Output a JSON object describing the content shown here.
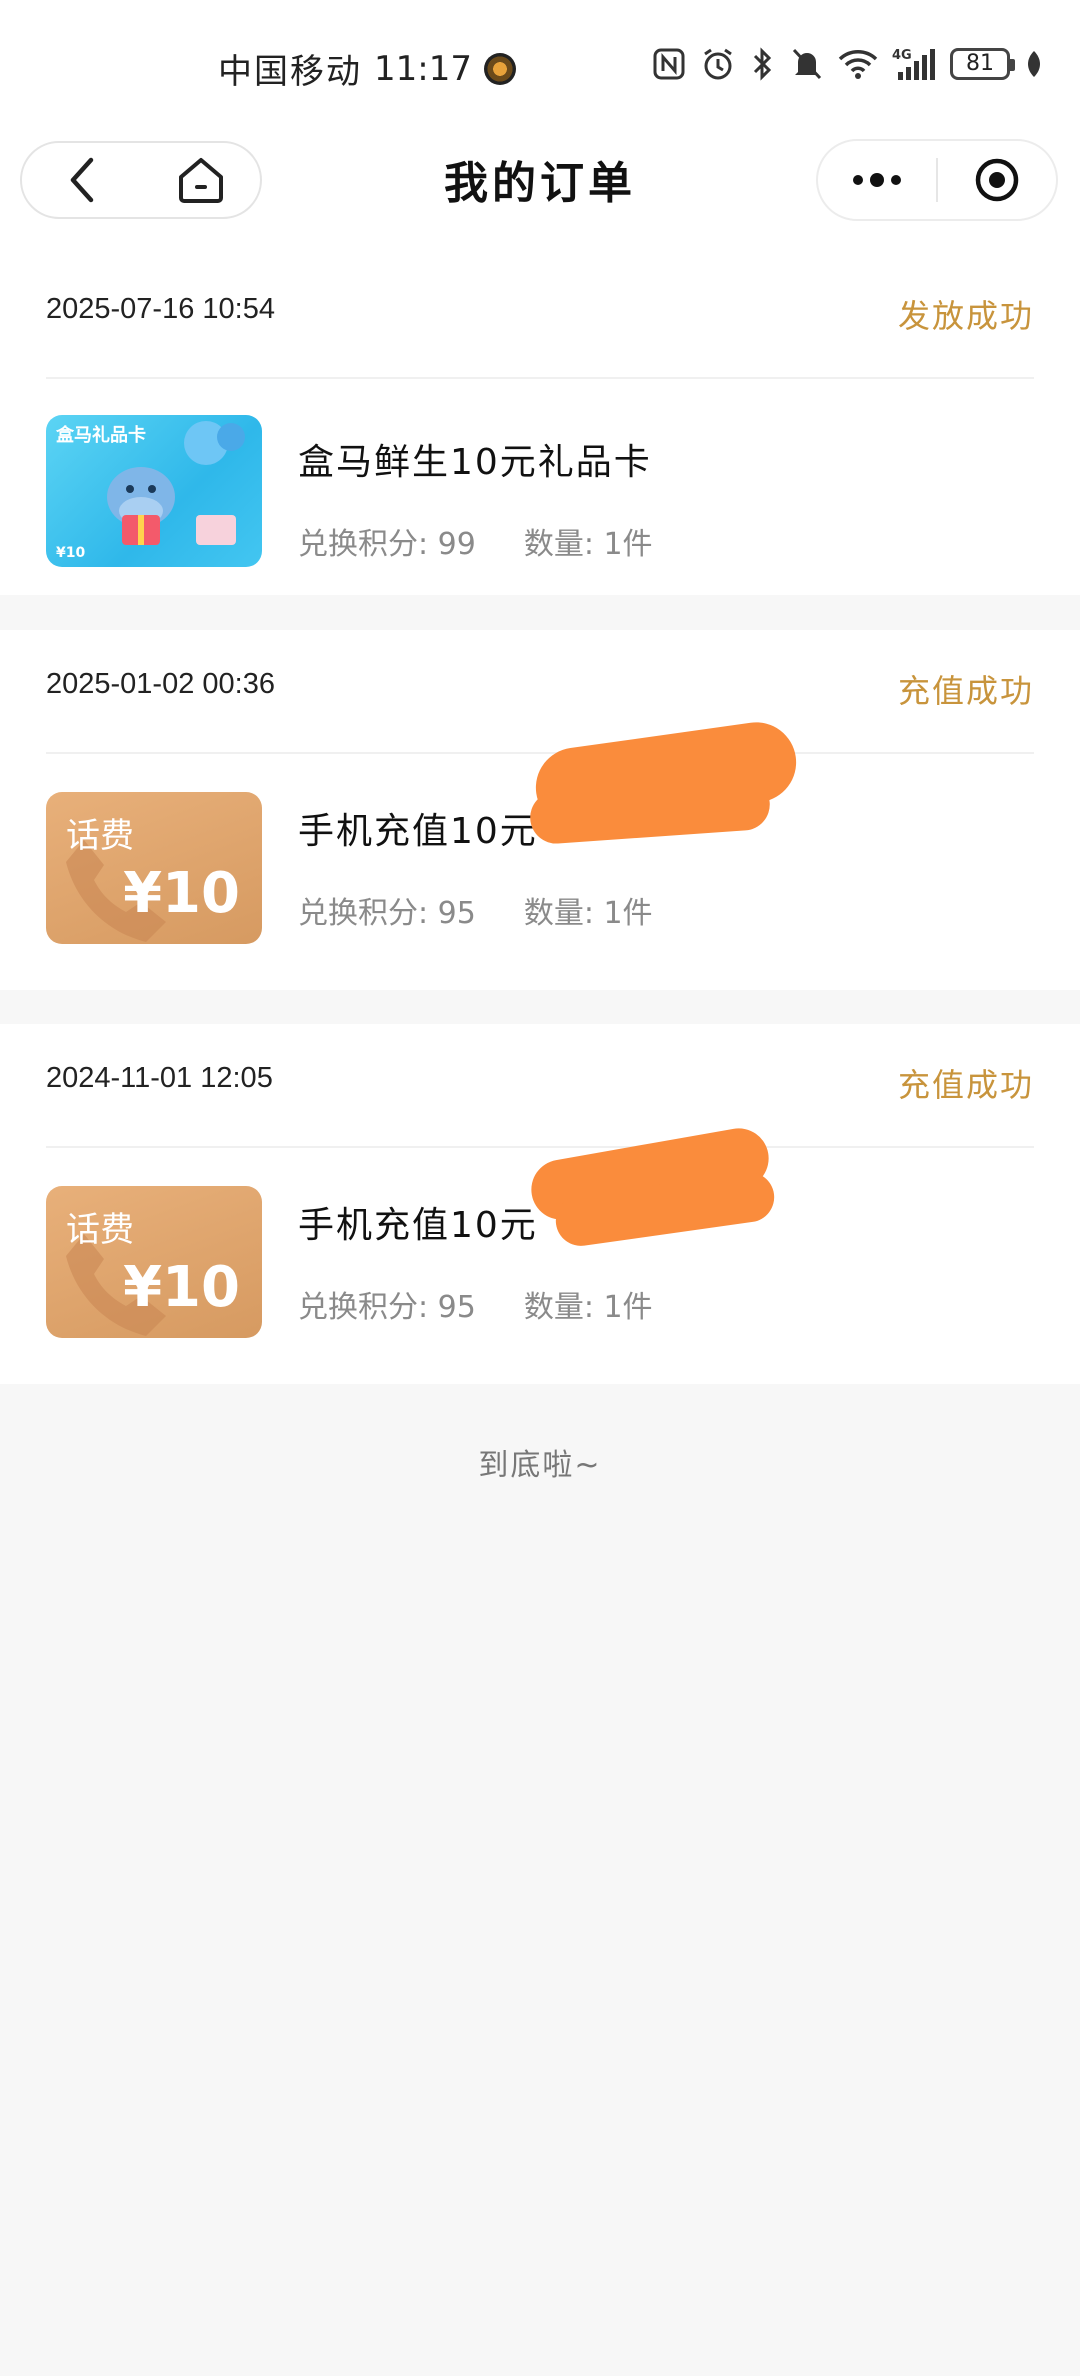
{
  "status_bar": {
    "carrier": "中国移动",
    "time": "11:17",
    "battery": "81"
  },
  "nav": {
    "title": "我的订单"
  },
  "orders": [
    {
      "datetime": "2025-07-16 10:54",
      "status": "发放成功",
      "thumb_label": "盒马礼品卡",
      "thumb_price": "¥10",
      "item_name": "盒马鲜生10元礼品卡",
      "points_label": "兑换积分: 99",
      "quantity_label": "数量: 1件"
    },
    {
      "datetime": "2025-01-02 00:36",
      "status": "充值成功",
      "thumb_label": "话费",
      "thumb_price": "¥10",
      "item_name": "手机充值10元",
      "points_label": "兑换积分: 95",
      "quantity_label": "数量: 1件"
    },
    {
      "datetime": "2024-11-01 12:05",
      "status": "充值成功",
      "thumb_label": "话费",
      "thumb_price": "¥10",
      "item_name": "手机充值10元",
      "points_label": "兑换积分: 95",
      "quantity_label": "数量: 1件"
    }
  ],
  "footer": {
    "end_text": "到底啦~"
  },
  "colors": {
    "accent": "#c8943c",
    "page_bg": "#f7f7f7",
    "redaction": "#fa8c3c"
  }
}
